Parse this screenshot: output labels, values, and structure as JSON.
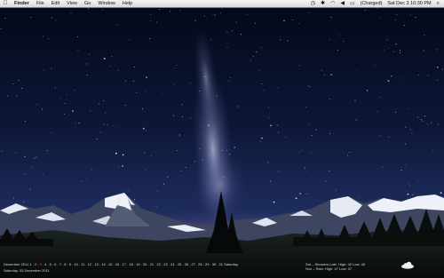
{
  "menubar": {
    "apple_icon": "",
    "menus": [
      "Finder",
      "File",
      "Edit",
      "View",
      "Go",
      "Window",
      "Help"
    ],
    "battery": "(Charged)",
    "clock": "Sat Dec 3  10:30 PM",
    "status_icons": [
      "time-machine-icon",
      "bluetooth-icon",
      "wifi-icon",
      "volume-icon",
      "battery-icon",
      "spotlight-icon"
    ]
  },
  "widgets": {
    "calendar": {
      "month_label": "December 2011",
      "days_before": [
        "1",
        "2",
        "3"
      ],
      "days_after": "4 . 5 . 6 . 7 . 8 . 9 . 10 . 11 . 12 . 13 . 14 . 15 . 16 . 17 . 18 . 19 . 20 . 21 . 22 . 23 . 24 . 25 . 26 . 27 . 28 . 29 . 30 . 31",
      "weekday": "Saturday",
      "full_date": "Saturday, 03 December 2011"
    },
    "weather": {
      "line1": "Sat – Showers Late. High: 42 Low: 40",
      "line2": "Sun – Rain. High: 47 Low: 37"
    }
  },
  "colors": {
    "sky_top": "#050a1c",
    "sky_mid": "#14244a",
    "horizon_glow": "#6a5a9a",
    "calendar_today": "#ff4a4a"
  }
}
